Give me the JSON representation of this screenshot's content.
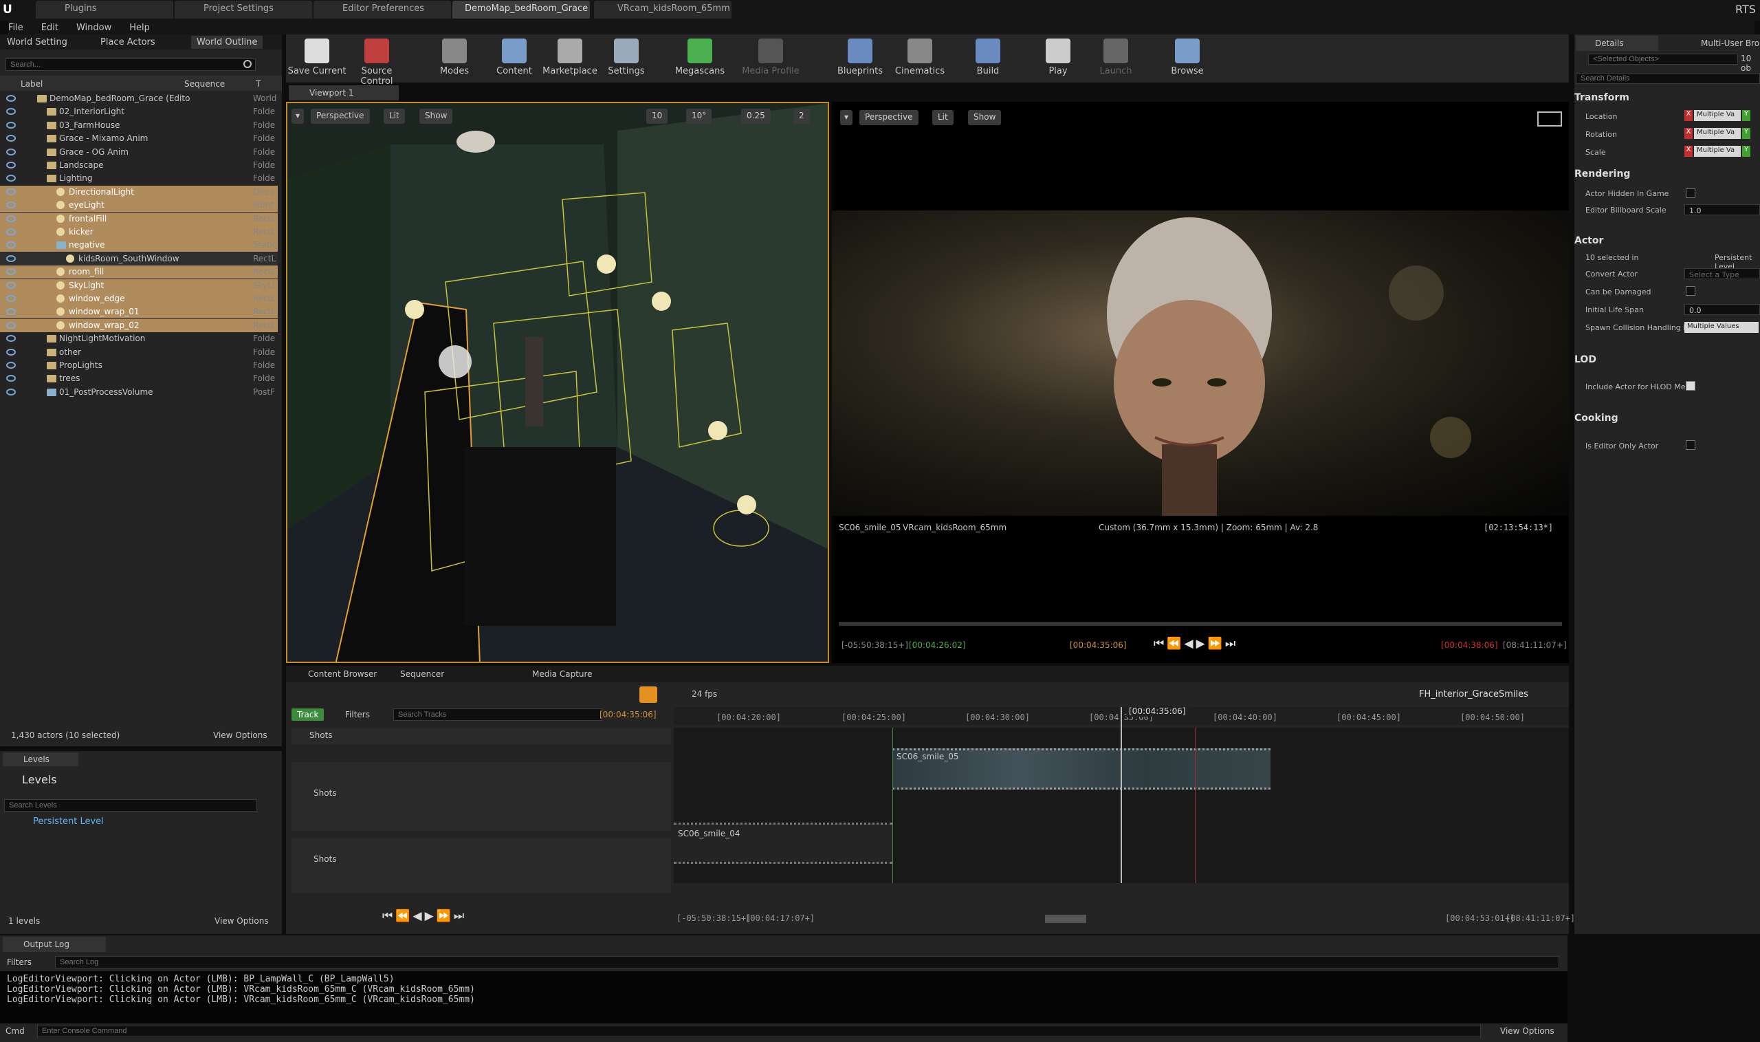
{
  "titlebar": {
    "tabs": [
      "Plugins",
      "Project Settings",
      "Editor Preferences",
      "DemoMap_bedRoom_Grace",
      "VRcam_kidsRoom_65mm"
    ],
    "right": "RTS"
  },
  "menu": [
    "File",
    "Edit",
    "Window",
    "Help"
  ],
  "left_tabs": [
    "World Setting",
    "Place Actors",
    "World Outline"
  ],
  "outliner": {
    "search_placeholder": "Search...",
    "col_label": "Label",
    "col_sequence": "Sequence",
    "col_type": "T",
    "rows": [
      {
        "label": "DemoMap_bedRoom_Grace (Edito",
        "type": "World",
        "indent": 0,
        "kind": "world"
      },
      {
        "label": "02_InteriorLight",
        "type": "Folde",
        "indent": 1,
        "kind": "folder"
      },
      {
        "label": "03_FarmHouse",
        "type": "Folde",
        "indent": 1,
        "kind": "folder"
      },
      {
        "label": "Grace - Mixamo Anim",
        "type": "Folde",
        "indent": 1,
        "kind": "folder"
      },
      {
        "label": "Grace - OG Anim",
        "type": "Folde",
        "indent": 1,
        "kind": "folder"
      },
      {
        "label": "Landscape",
        "type": "Folde",
        "indent": 1,
        "kind": "folder"
      },
      {
        "label": "Lighting",
        "type": "Folde",
        "indent": 1,
        "kind": "folder"
      },
      {
        "label": "DirectionalLight",
        "type": "Direc",
        "indent": 2,
        "kind": "light",
        "sel": true
      },
      {
        "label": "eyeLight",
        "type": "Point",
        "indent": 2,
        "kind": "light",
        "sel": true
      },
      {
        "label": "frontalFill",
        "type": "RectL",
        "indent": 2,
        "kind": "light",
        "sel": true
      },
      {
        "label": "kicker",
        "type": "RectL",
        "indent": 2,
        "kind": "light",
        "sel": true
      },
      {
        "label": "negative",
        "type": "Static",
        "indent": 2,
        "kind": "mesh",
        "sel": true
      },
      {
        "label": "kidsRoom_SouthWindow",
        "type": "RectL",
        "indent": 3,
        "kind": "light",
        "sel": false
      },
      {
        "label": "room_fill",
        "type": "RectL",
        "indent": 2,
        "kind": "light",
        "sel": true
      },
      {
        "label": "SkyLight",
        "type": "SkyLi",
        "indent": 2,
        "kind": "light",
        "sel": true
      },
      {
        "label": "window_edge",
        "type": "RectL",
        "indent": 2,
        "kind": "light",
        "sel": true
      },
      {
        "label": "window_wrap_01",
        "type": "RectL",
        "indent": 2,
        "kind": "light",
        "sel": true
      },
      {
        "label": "window_wrap_02",
        "type": "RectL",
        "indent": 2,
        "kind": "light",
        "sel": true
      },
      {
        "label": "NightLightMotivation",
        "type": "Folde",
        "indent": 1,
        "kind": "folder"
      },
      {
        "label": "other",
        "type": "Folde",
        "indent": 1,
        "kind": "folder"
      },
      {
        "label": "PropLights",
        "type": "Folde",
        "indent": 1,
        "kind": "folder"
      },
      {
        "label": "trees",
        "type": "Folde",
        "indent": 1,
        "kind": "folder"
      },
      {
        "label": "01_PostProcessVolume",
        "type": "PostF",
        "indent": 1,
        "kind": "mesh"
      }
    ],
    "status": "1,430 actors (10 selected)",
    "view_options": "View Options"
  },
  "levels": {
    "tab": "Levels",
    "title": "Levels",
    "search_placeholder": "Search Levels",
    "item": "Persistent Level",
    "status": "1 levels",
    "view_options": "View Options"
  },
  "toolbar": [
    "Save Current",
    "Source Control",
    "Modes",
    "Content",
    "Marketplace",
    "Settings",
    "Megascans",
    "Media Profile",
    "Blueprints",
    "Cinematics",
    "Build",
    "Play",
    "Launch",
    "Browse"
  ],
  "viewport1": {
    "tab": "Viewport 1",
    "perspective": "Perspective",
    "lit": "Lit",
    "show": "Show",
    "grid": "10",
    "angle": "10°",
    "scale": "0.25",
    "cam": "2"
  },
  "viewport2": {
    "perspective": "Perspective",
    "lit": "Lit",
    "show": "Show",
    "shot": "SC06_smile_05",
    "camera": "VRcam_kidsRoom_65mm",
    "info": "Custom (36.7mm x 15.3mm) | Zoom: 65mm | Av: 2.8",
    "tc": "[02:13:54:13*]",
    "tc_start": "[-05:50:38:15+]",
    "tc_in": "[00:04:26:02]",
    "tc_cur": "[00:04:35:06]",
    "tc_out": "[00:04:38:06]",
    "tc_end": "[08:41:11:07+]"
  },
  "bottom_tabs": [
    "Content Browser",
    "Sequencer",
    "Media Capture"
  ],
  "sequencer": {
    "fps": "24 fps",
    "sequence": "FH_interior_GraceSmiles",
    "track_btn": "Track",
    "filters": "Filters",
    "search_placeholder": "Search Tracks",
    "current": "[00:04:35:06]",
    "playhead": "[00:04:35:06]",
    "ruler": [
      "[00:04:20:00]",
      "[00:04:25:00]",
      "[00:04:30:00]",
      "[00:04:35:00]",
      "[00:04:40:00]",
      "[00:04:45:00]",
      "[00:04:50:00]"
    ],
    "tracks": [
      "Shots",
      "Shots",
      "Shots"
    ],
    "clip1": "SC06_smile_05",
    "clip2": "SC06_smile_04",
    "tc_start": "[-05:50:38:15+]",
    "tc_in": "[00:04:17:07+]",
    "tc_out": "[00:04:53:01+]",
    "tc_end": "[08:41:11:07+]"
  },
  "details": {
    "tab": "Details",
    "tab2": "Multi-User Bro",
    "selected_placeholder": "<Selected Objects>",
    "count": "10 ob",
    "search_placeholder": "Search Details",
    "transform": "Transform",
    "location": "Location",
    "rotation": "Rotation",
    "scale": "Scale",
    "multi": "Multiple Va",
    "rendering": "Rendering",
    "hidden": "Actor Hidden In Game",
    "billboard": "Editor Billboard Scale",
    "billboard_val": "1.0",
    "actor": "Actor",
    "selected_in": "10 selected in",
    "persistent": "Persistent Level",
    "convert": "Convert Actor",
    "select_type": "Select a Type",
    "damaged": "Can be Damaged",
    "lifespan": "Initial Life Span",
    "lifespan_val": "0.0",
    "spawn": "Spawn Collision Handling M",
    "spawn_val": "Multiple Values",
    "lod": "LOD",
    "hlod": "Include Actor for HLOD Mes",
    "cooking": "Cooking",
    "editor_only": "Is Editor Only Actor"
  },
  "output": {
    "tab": "Output Log",
    "filters": "Filters",
    "search_placeholder": "Search Log",
    "lines": [
      "LogEditorViewport: Clicking on Actor (LMB): BP_LampWall_C (BP_LampWall5)",
      "LogEditorViewport: Clicking on Actor (LMB): VRcam_kidsRoom_65mm_C (VRcam_kidsRoom_65mm)",
      "LogEditorViewport: Clicking on Actor (LMB): VRcam_kidsRoom_65mm_C (VRcam_kidsRoom_65mm)"
    ],
    "cmd": "Cmd",
    "cmd_placeholder": "Enter Console Command",
    "view_options": "View Options"
  }
}
